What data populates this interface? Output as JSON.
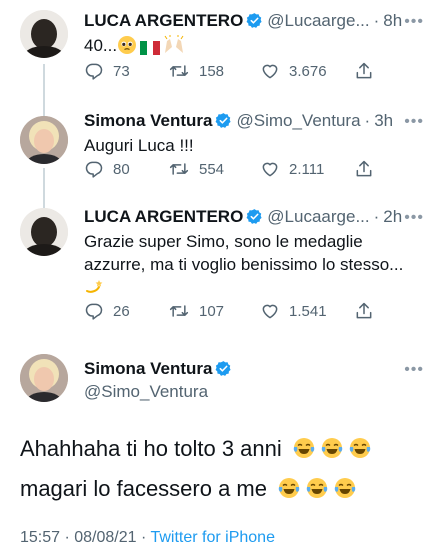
{
  "colors": {
    "verified": "#1d9bf0",
    "muted": "#536471",
    "link": "#1d9bf0",
    "thread_line": "#cfd9de"
  },
  "tweets": [
    {
      "name": "LUCA ARGENTERO",
      "handle": "@Lucaarge...",
      "dot": "·",
      "time": "8h",
      "text": "40...",
      "emojis": [
        "pleading-face-emoji",
        "italy-flag-emoji",
        "raising-hands-emoji"
      ],
      "replies": "73",
      "retweets": "158",
      "likes": "3.676"
    },
    {
      "name": "Simona Ventura",
      "handle": "@Simo_Ventura",
      "dot": "·",
      "time": "3h",
      "text": "Auguri Luca !!!",
      "replies": "80",
      "retweets": "554",
      "likes": "2.111"
    },
    {
      "name": "LUCA ARGENTERO",
      "handle": "@Lucaarge...",
      "dot": "·",
      "time": "2h",
      "text_line1": "Grazie super Simo, sono le medaglie",
      "text_line2": "azzurre, ma ti voglio benissimo lo stesso...",
      "emojis": [
        "dizzy-emoji"
      ],
      "replies": "26",
      "retweets": "107",
      "likes": "1.541"
    }
  ],
  "main": {
    "name": "Simona Ventura",
    "handle": "@Simo_Ventura",
    "line1": "Ahahhaha ti ho tolto 3 anni",
    "line2": "magari lo facessero a me",
    "emojis": [
      "tears-of-joy-emoji"
    ],
    "timestamp": "15:57 · 08/08/21 ·",
    "source": "Twitter for iPhone"
  },
  "more_label": "•••"
}
